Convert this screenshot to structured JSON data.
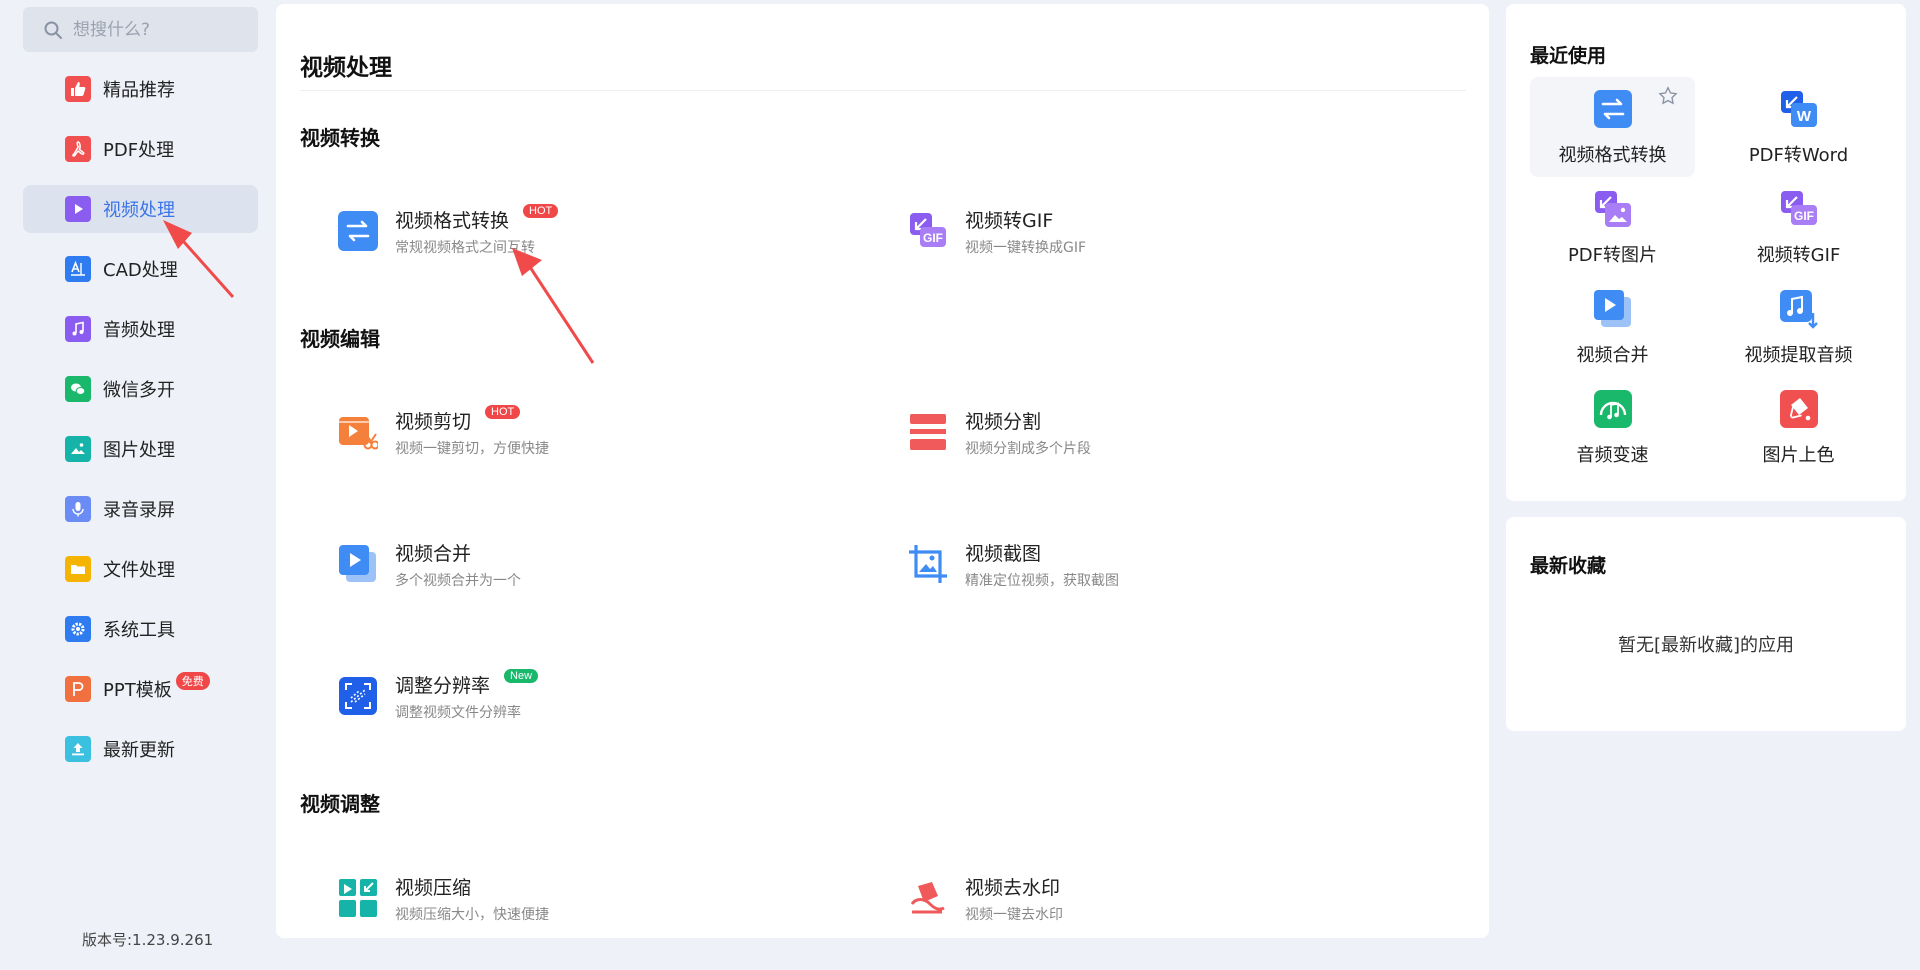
{
  "search": {
    "placeholder": "想搜什么?"
  },
  "sidebar": {
    "items": [
      {
        "label": "精品推荐",
        "icon": "thumbs-up-icon",
        "color": "#f05050"
      },
      {
        "label": "PDF处理",
        "icon": "pdf-icon",
        "color": "#f05050"
      },
      {
        "label": "视频处理",
        "icon": "play-icon",
        "color": "#8a5cf0",
        "active": true
      },
      {
        "label": "CAD处理",
        "icon": "cad-icon",
        "color": "#2f7cf0"
      },
      {
        "label": "音频处理",
        "icon": "music-icon",
        "color": "#8a5cf0"
      },
      {
        "label": "微信多开",
        "icon": "wechat-icon",
        "color": "#19b86b"
      },
      {
        "label": "图片处理",
        "icon": "image-icon",
        "color": "#16b3a8"
      },
      {
        "label": "录音录屏",
        "icon": "mic-icon",
        "color": "#6b8cf5"
      },
      {
        "label": "文件处理",
        "icon": "folder-icon",
        "color": "#f5b400"
      },
      {
        "label": "系统工具",
        "icon": "gear-icon",
        "color": "#2f7cf0"
      },
      {
        "label": "PPT模板",
        "icon": "ppt-icon",
        "color": "#f07040",
        "badge": "免费"
      },
      {
        "label": "最新更新",
        "icon": "upload-icon",
        "color": "#3cc0e0"
      }
    ],
    "version": "版本号:1.23.9.261"
  },
  "main": {
    "title": "视频处理",
    "sections": [
      {
        "title": "视频转换",
        "tools": [
          {
            "name": "视频格式转换",
            "desc": "常规视频格式之间互转",
            "badge": "HOT"
          },
          {
            "name": "视频转GIF",
            "desc": "视频一键转换成GIF"
          }
        ]
      },
      {
        "title": "视频编辑",
        "tools": [
          {
            "name": "视频剪切",
            "desc": "视频一键剪切，方便快捷",
            "badge": "HOT"
          },
          {
            "name": "视频分割",
            "desc": "视频分割成多个片段"
          },
          {
            "name": "视频合并",
            "desc": "多个视频合并为一个"
          },
          {
            "name": "视频截图",
            "desc": "精准定位视频，获取截图"
          },
          {
            "name": "调整分辨率",
            "desc": "调整视频文件分辨率",
            "badge": "New"
          }
        ]
      },
      {
        "title": "视频调整",
        "tools": [
          {
            "name": "视频压缩",
            "desc": "视频压缩大小，快速便捷"
          },
          {
            "name": "视频去水印",
            "desc": "视频一键去水印"
          }
        ]
      }
    ]
  },
  "recent": {
    "title": "最近使用",
    "items": [
      {
        "label": "视频格式转换"
      },
      {
        "label": "PDF转Word"
      },
      {
        "label": "PDF转图片"
      },
      {
        "label": "视频转GIF"
      },
      {
        "label": "视频合并"
      },
      {
        "label": "视频提取音频"
      },
      {
        "label": "音频变速"
      },
      {
        "label": "图片上色"
      }
    ]
  },
  "favorites": {
    "title": "最新收藏",
    "empty": "暂无[最新收藏]的应用"
  },
  "colors": {
    "accent": "#3b74e8",
    "hot": "#f04848",
    "new": "#19b86b"
  }
}
